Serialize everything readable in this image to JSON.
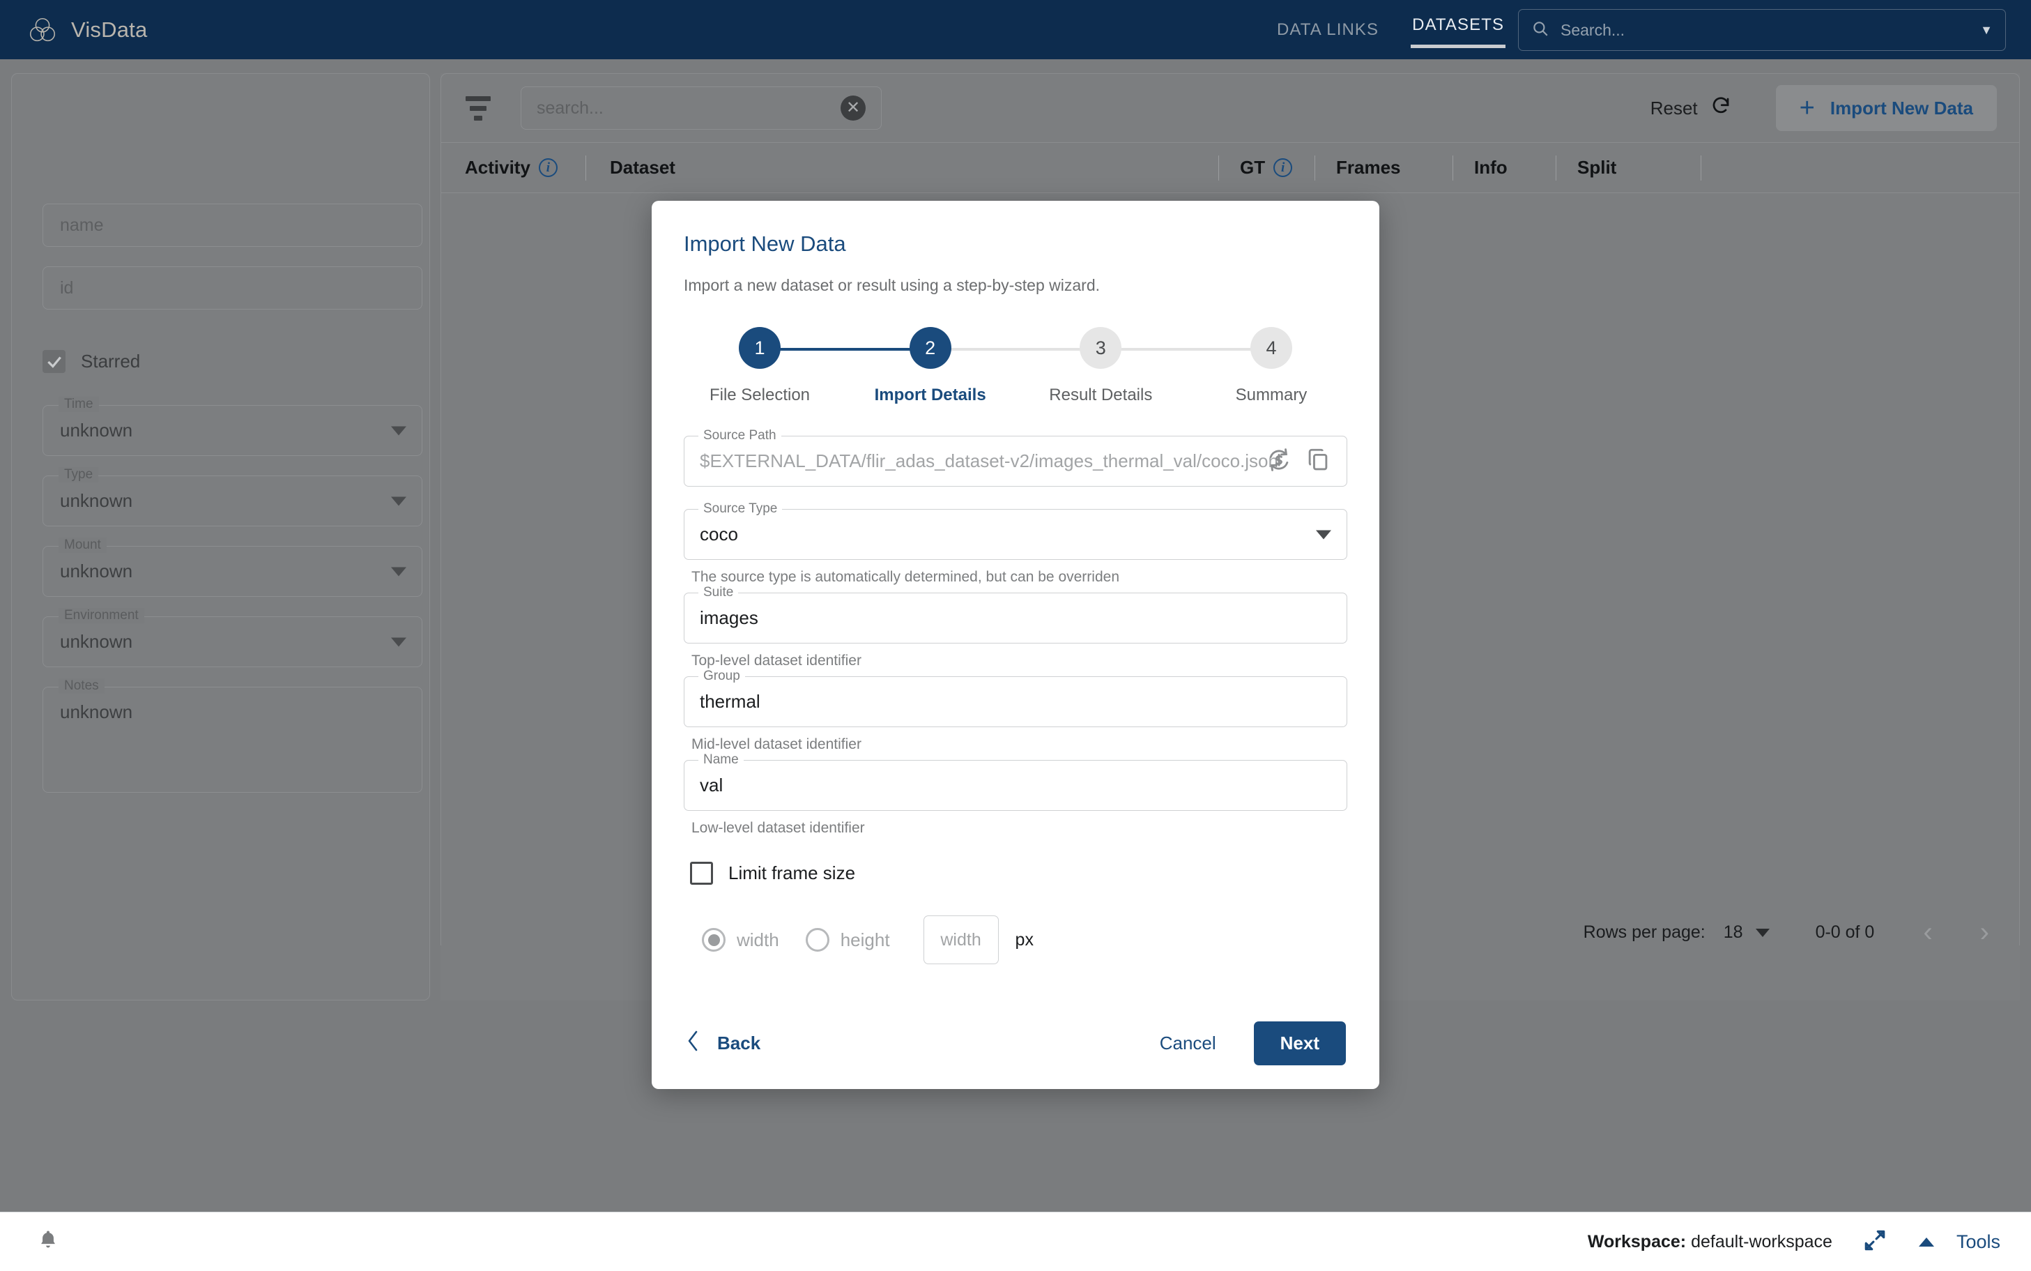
{
  "app": {
    "brand_name": "VisData",
    "brand_logo_icon": "venn-logo-icon"
  },
  "topnav": {
    "links": [
      {
        "label": "DATA LINKS",
        "active": false
      },
      {
        "label": "DATASETS",
        "active": true
      }
    ],
    "search": {
      "placeholder": "Search...",
      "icon": "search-icon",
      "caret_icon": "chevron-down-icon"
    }
  },
  "sidebar": {
    "name_placeholder": "name",
    "id_placeholder": "id",
    "starred": {
      "label": "Starred",
      "checked": true,
      "icon": "check-icon"
    },
    "selects": [
      {
        "legend": "Time",
        "value": "unknown"
      },
      {
        "legend": "Type",
        "value": "unknown"
      },
      {
        "legend": "Mount",
        "value": "unknown"
      },
      {
        "legend": "Environment",
        "value": "unknown"
      }
    ],
    "notes": {
      "legend": "Notes",
      "value": "unknown"
    }
  },
  "toolbar": {
    "filter_icon": "filter-icon",
    "search_placeholder": "search...",
    "clear_icon": "clear-circle-icon",
    "reset_label": "Reset",
    "reset_icon": "refresh-icon",
    "import_label": "Import New Data",
    "import_icon": "plus-icon"
  },
  "table": {
    "columns": [
      {
        "label": "Activity",
        "info": true
      },
      {
        "label": "Dataset",
        "info": false
      },
      {
        "label": "GT",
        "info": true
      },
      {
        "label": "Frames",
        "info": false
      },
      {
        "label": "Info",
        "info": false
      },
      {
        "label": "Split",
        "info": false
      }
    ],
    "rows": []
  },
  "pagination": {
    "rows_per_page_label": "Rows per page:",
    "rows_per_page_value": "18",
    "range": "0-0 of 0",
    "prev_icon": "chevron-left-icon",
    "next_icon": "chevron-right-icon"
  },
  "dialog": {
    "title": "Import New Data",
    "subtitle": "Import a new dataset or result using a step-by-step wizard.",
    "steps": [
      {
        "num": "1",
        "label": "File Selection",
        "state": "done"
      },
      {
        "num": "2",
        "label": "Import Details",
        "state": "active"
      },
      {
        "num": "3",
        "label": "Result Details",
        "state": "todo"
      },
      {
        "num": "4",
        "label": "Summary",
        "state": "todo"
      }
    ],
    "source_path": {
      "legend": "Source Path",
      "value": "$EXTERNAL_DATA/flir_adas_dataset-v2/images_thermal_val/coco.json",
      "substitute_icon": "substitute-variable-icon",
      "copy_icon": "copy-icon"
    },
    "source_type": {
      "legend": "Source Type",
      "value": "coco",
      "caret_icon": "chevron-down-icon",
      "helper": "The source type is automatically determined, but can be overriden"
    },
    "suite": {
      "legend": "Suite",
      "value": "images",
      "helper": "Top-level dataset identifier"
    },
    "group": {
      "legend": "Group",
      "value": "thermal",
      "helper": "Mid-level dataset identifier"
    },
    "name": {
      "legend": "Name",
      "value": "val",
      "helper": "Low-level dataset identifier"
    },
    "limit_frame_size": {
      "label": "Limit frame size",
      "checked": false
    },
    "dimension": {
      "options": [
        {
          "label": "width",
          "selected": true
        },
        {
          "label": "height",
          "selected": false
        }
      ],
      "input_placeholder": "width",
      "unit": "px"
    },
    "footer": {
      "back_label": "Back",
      "back_icon": "chevron-left-icon",
      "cancel_label": "Cancel",
      "next_label": "Next"
    }
  },
  "statusbar": {
    "bell_icon": "bell-icon",
    "workspace_label": "Workspace:",
    "workspace_value": "default-workspace",
    "expand_icon": "expand-diagonal-icon",
    "caret_icon": "chevron-up-icon",
    "tools_label": "Tools"
  },
  "colors": {
    "brand_navy": "#0d2c4e",
    "accent_blue": "#1a4b7d",
    "scrim_gray": "#7a7c7e",
    "step_inactive": "#e6e6e6"
  }
}
